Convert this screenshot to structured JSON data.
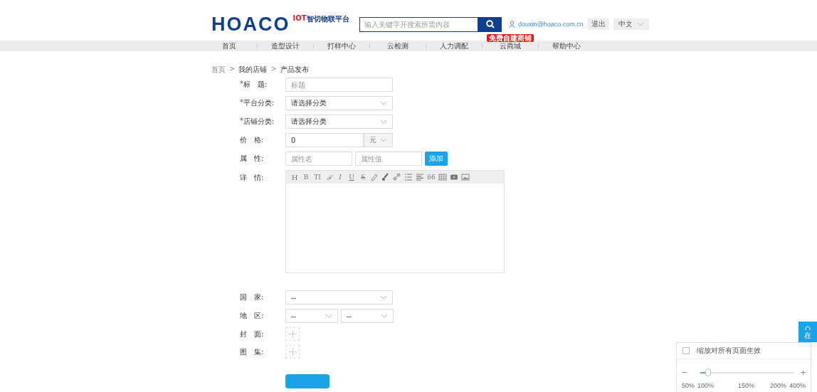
{
  "header": {
    "logo": "HOACO",
    "logo_tag_red": "IOT",
    "logo_tag": "智切物联平台",
    "search": {
      "placeholder": "输入关键字开搜索所需内容"
    },
    "user_email": "douxin@hoaco.com.cn",
    "logout": "退出",
    "language": "中文"
  },
  "nav": [
    {
      "label": "首页"
    },
    {
      "label": "造型设计"
    },
    {
      "label": "打样中心"
    },
    {
      "label": "云检测"
    },
    {
      "label": "人力调配"
    },
    {
      "label": "云商城",
      "badge": "免费自建商铺"
    },
    {
      "label": "帮助中心"
    }
  ],
  "breadcrumb": {
    "separator": ">",
    "items": [
      "首页",
      "我的店铺",
      "产品发布"
    ]
  },
  "required_mark": "*",
  "form": [
    {
      "kind": "text",
      "required": true,
      "label": "标　题:",
      "placeholder": "标题"
    },
    {
      "kind": "select",
      "required": true,
      "label": "平台分类:",
      "value": "请选择分类"
    },
    {
      "kind": "select",
      "required": true,
      "label": "店铺分类:",
      "value": "请选择分类"
    },
    {
      "kind": "price",
      "required": false,
      "label": "价　格:",
      "value": "0",
      "unit": "元"
    },
    {
      "kind": "attr",
      "required": false,
      "label": "属　性:",
      "placeholders": [
        "属性名",
        "属性值"
      ],
      "button": "添加"
    },
    {
      "kind": "editor",
      "required": false,
      "label": "详　情:",
      "tools": [
        {
          "kind": "text",
          "label": "H"
        },
        {
          "kind": "text",
          "label": "B"
        },
        {
          "kind": "text",
          "label": "TI"
        },
        {
          "kind": "text",
          "label": "ℱ"
        },
        {
          "kind": "text",
          "label": "I"
        },
        {
          "kind": "text",
          "label": "U"
        },
        {
          "kind": "text",
          "label": "S"
        },
        {
          "kind": "eraser"
        },
        {
          "kind": "brush"
        },
        {
          "kind": "link"
        },
        {
          "kind": "list"
        },
        {
          "kind": "align"
        },
        {
          "kind": "text",
          "label": "66"
        },
        {
          "kind": "table"
        },
        {
          "kind": "video"
        },
        {
          "kind": "image"
        }
      ]
    },
    {
      "kind": "select",
      "required": false,
      "label": "国　家:",
      "value": "--"
    },
    {
      "kind": "select2",
      "required": false,
      "label": "地　区:",
      "values": [
        "--",
        "--"
      ]
    },
    {
      "kind": "upload",
      "required": false,
      "label": "封　面:"
    },
    {
      "kind": "upload",
      "required": false,
      "label": "图　集:"
    },
    {
      "kind": "submit"
    }
  ],
  "side_tab": {
    "label": "在"
  },
  "zoom_panel": {
    "checkbox": {
      "label": "缩放对所有页面生效",
      "checked": false
    },
    "minus": "−",
    "plus": "+",
    "level": 0.08,
    "ticks": [
      "50%",
      "100%",
      "150%",
      "200%",
      "400%"
    ]
  }
}
